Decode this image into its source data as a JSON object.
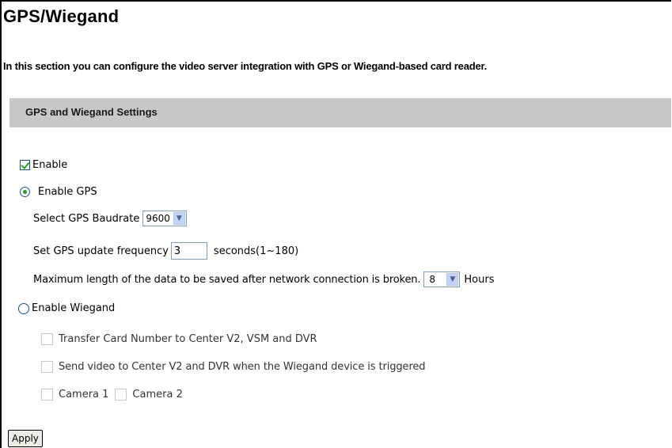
{
  "page": {
    "title": "GPS/Wiegand",
    "intro": "In this section you can configure the video server integration with GPS or Wiegand-based card reader."
  },
  "section": {
    "title": "GPS and Wiegand Settings"
  },
  "enable": {
    "label": "Enable",
    "checked": true
  },
  "gps": {
    "label": "Enable GPS",
    "selected": true,
    "baudrate_label": "Select GPS Baudrate",
    "baudrate_value": "9600",
    "frequency_label": "Set GPS update frequency",
    "frequency_value": "3",
    "frequency_suffix": "seconds(1~180)",
    "maxlength_label": "Maximum length of the data to be saved after network connection is broken.",
    "maxlength_value": "8",
    "maxlength_suffix": "Hours"
  },
  "wiegand": {
    "label": "Enable Wiegand",
    "selected": false,
    "transfer_label": "Transfer Card Number to Center V2, VSM and DVR",
    "send_video_label": "Send video to Center V2 and DVR when the Wiegand device is triggered",
    "camera1_label": "Camera 1",
    "camera2_label": "Camera 2"
  },
  "apply_label": "Apply",
  "colors": {
    "section_bar": "#c8c8c8",
    "check_green": "#21a121",
    "control_border": "#1c5180"
  }
}
